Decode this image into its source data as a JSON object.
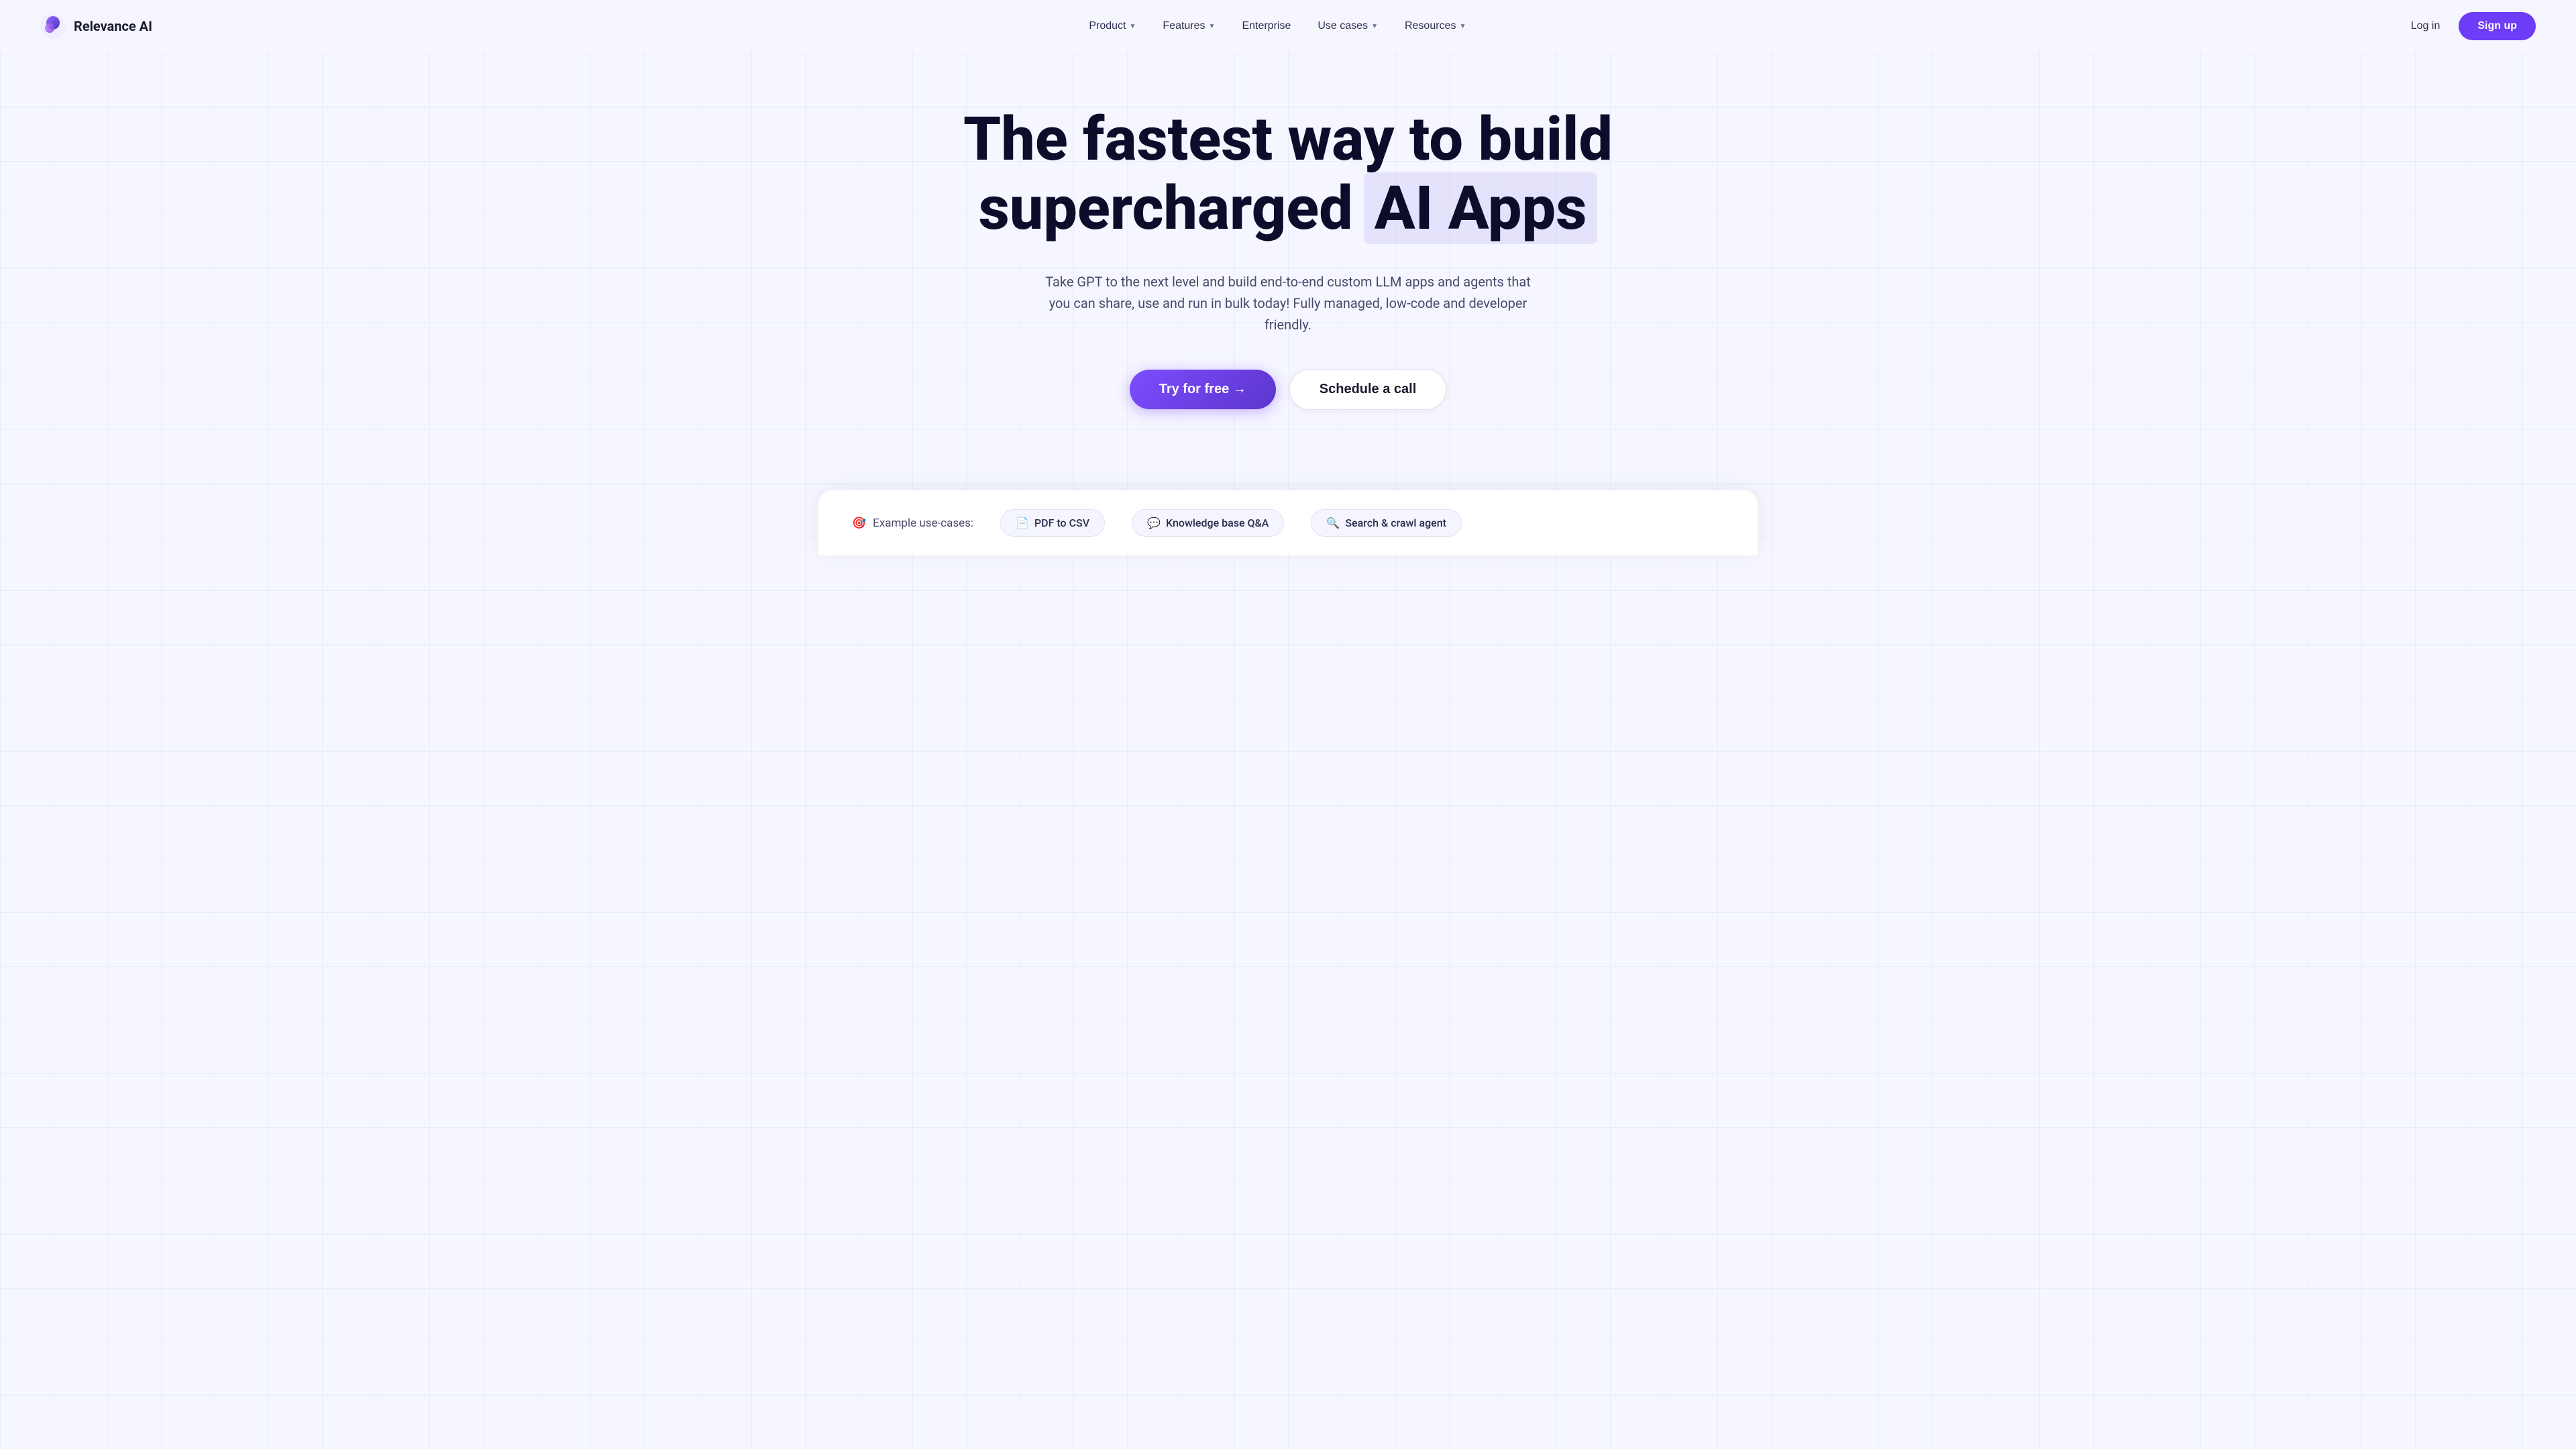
{
  "brand": {
    "name": "Relevance AI",
    "logo_emoji": "🔮"
  },
  "nav": {
    "links": [
      {
        "label": "Product",
        "has_dropdown": true
      },
      {
        "label": "Features",
        "has_dropdown": true
      },
      {
        "label": "Enterprise",
        "has_dropdown": false
      },
      {
        "label": "Use cases",
        "has_dropdown": true
      },
      {
        "label": "Resources",
        "has_dropdown": true
      }
    ],
    "login_label": "Log in",
    "signup_label": "Sign up"
  },
  "hero": {
    "title_line1": "The fastest way to build",
    "title_line2a": "supercharged",
    "title_line2b": "AI Apps",
    "subtitle": "Take GPT to the next level and build end-to-end custom LLM apps and agents that you can share, use and run in bulk today! Fully managed, low-code and developer friendly.",
    "cta_primary": "Try for free →",
    "cta_secondary": "Schedule a call"
  },
  "use_cases": {
    "label": "Example use-cases:",
    "label_emoji": "🎯",
    "items": [
      {
        "icon": "📄",
        "label": "PDF to CSV"
      },
      {
        "icon": "💬",
        "label": "Knowledge base Q&A"
      },
      {
        "icon": "🔍",
        "label": "Search & crawl agent"
      }
    ]
  }
}
